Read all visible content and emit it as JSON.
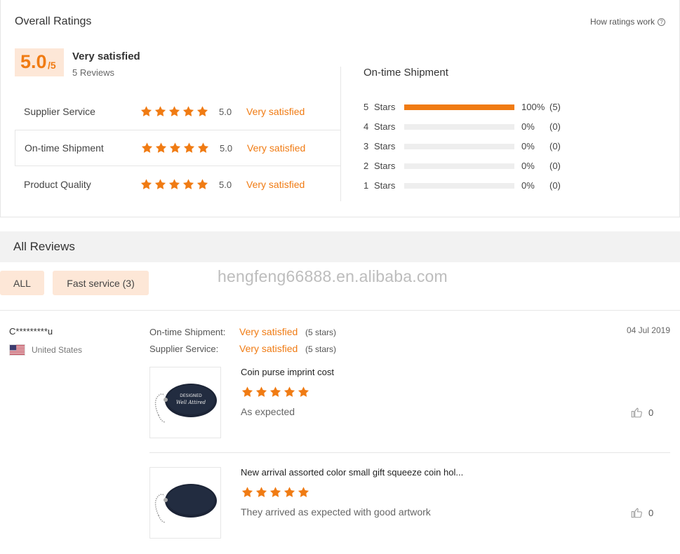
{
  "overall": {
    "title": "Overall Ratings",
    "how_link": "How ratings work",
    "score": "5.0",
    "score_suffix": "/5",
    "label": "Very satisfied",
    "review_count": "5 Reviews"
  },
  "categories": [
    {
      "name": "Supplier Service",
      "score": "5.0",
      "text": "Very satisfied",
      "stars": 5
    },
    {
      "name": "On-time Shipment",
      "score": "5.0",
      "text": "Very satisfied",
      "stars": 5
    },
    {
      "name": "Product Quality",
      "score": "5.0",
      "text": "Very satisfied",
      "stars": 5
    }
  ],
  "distribution": {
    "title": "On-time Shipment",
    "stars_word": "Stars",
    "rows": [
      {
        "num": "5",
        "percent": "100%",
        "count": "(5)",
        "fill": 1.0
      },
      {
        "num": "4",
        "percent": "0%",
        "count": "(0)",
        "fill": 0
      },
      {
        "num": "3",
        "percent": "0%",
        "count": "(0)",
        "fill": 0
      },
      {
        "num": "2",
        "percent": "0%",
        "count": "(0)",
        "fill": 0
      },
      {
        "num": "1",
        "percent": "0%",
        "count": "(0)",
        "fill": 0
      }
    ]
  },
  "reviews_section": {
    "title": "All Reviews",
    "filters": [
      {
        "label": "ALL"
      },
      {
        "label": "Fast service (3)"
      }
    ],
    "watermark": "hengfeng66888.en.alibaba.com"
  },
  "review": {
    "reviewer": "C*********u",
    "country": "United States",
    "date": "04 Jul 2019",
    "meta": [
      {
        "label": "On-time Shipment:",
        "value": "Very satisfied",
        "stars_text": "(5 stars)"
      },
      {
        "label": "Supplier Service:",
        "value": "Very satisfied",
        "stars_text": "(5 stars)"
      }
    ],
    "items": [
      {
        "title": "Coin purse imprint cost",
        "stars": 5,
        "comment": "As expected",
        "likes": "0",
        "thumb_text": "DESIGNED Well Attired"
      },
      {
        "title": "New arrival assorted color small gift squeeze coin hol...",
        "stars": 5,
        "comment": "They arrived as expected with good artwork",
        "likes": "0",
        "thumb_text": ""
      }
    ]
  },
  "colors": {
    "accent": "#f07b13",
    "accent_bg": "#fde7d7",
    "bar_bg": "#eeeeee"
  }
}
